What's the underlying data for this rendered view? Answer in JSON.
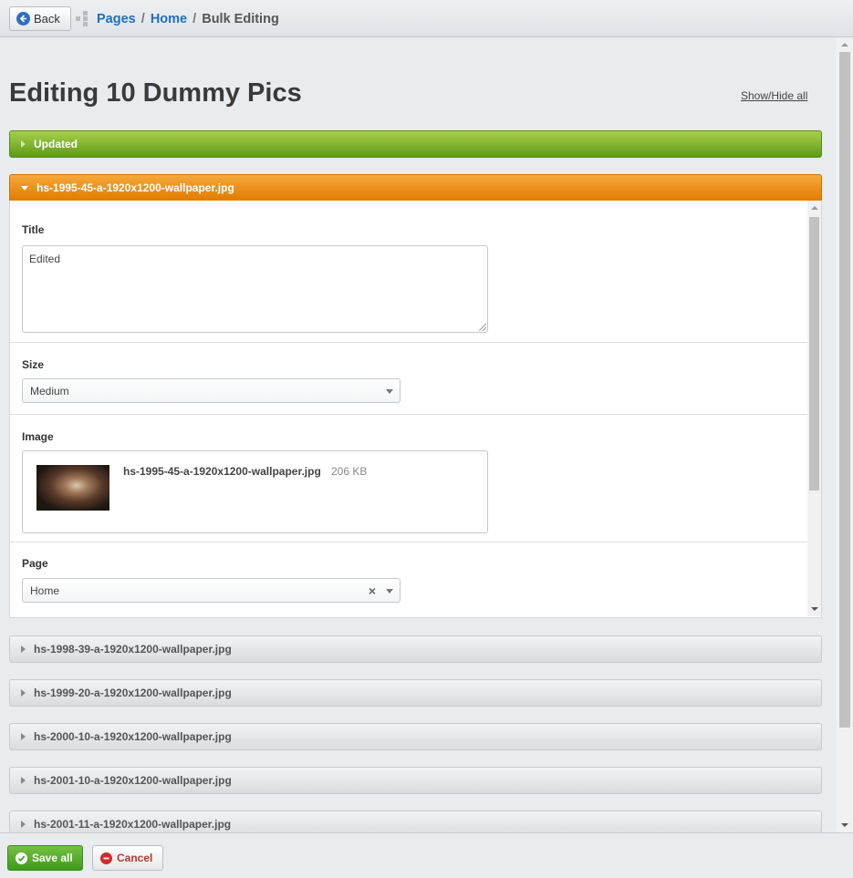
{
  "topbar": {
    "back_label": "Back",
    "breadcrumb": [
      "Pages",
      "Home",
      "Bulk Editing"
    ]
  },
  "page": {
    "title": "Editing 10 Dummy Pics",
    "show_hide_label": "Show/Hide all"
  },
  "accordion": {
    "updated_label": "Updated",
    "open_item": "hs-1995-45-a-1920x1200-wallpaper.jpg",
    "collapsed_items": [
      "hs-1998-39-a-1920x1200-wallpaper.jpg",
      "hs-1999-20-a-1920x1200-wallpaper.jpg",
      "hs-2000-10-a-1920x1200-wallpaper.jpg",
      "hs-2001-10-a-1920x1200-wallpaper.jpg",
      "hs-2001-11-a-1920x1200-wallpaper.jpg"
    ]
  },
  "form": {
    "title_label": "Title",
    "title_value": "Edited",
    "size_label": "Size",
    "size_value": "Medium",
    "image_label": "Image",
    "image_filename": "hs-1995-45-a-1920x1200-wallpaper.jpg",
    "image_size": "206 KB",
    "page_label": "Page",
    "page_value": "Home"
  },
  "footer": {
    "save_label": "Save all",
    "cancel_label": "Cancel"
  },
  "colors": {
    "updated_bar": "#6ea61f",
    "active_bar": "#ef8c12",
    "link": "#1f6fbd",
    "save_button": "#4ea52a",
    "cancel_text": "#c0392b"
  }
}
